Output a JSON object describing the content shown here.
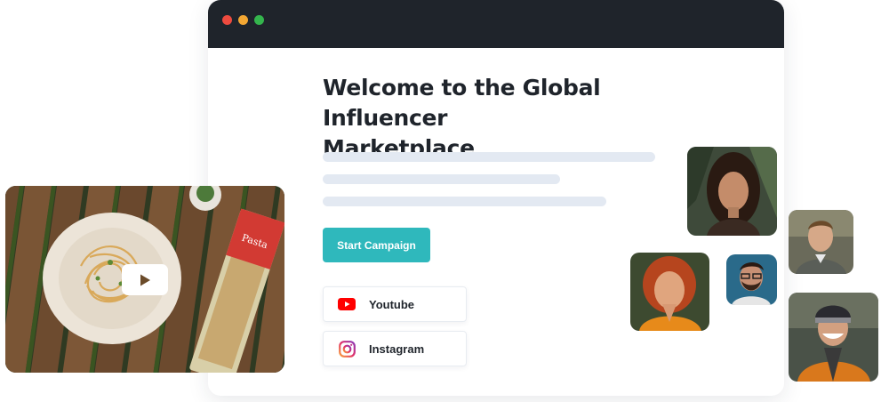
{
  "window": {
    "controls": [
      "close",
      "minimize",
      "maximize"
    ]
  },
  "hero": {
    "title_line1": "Welcome to the Global Influencer",
    "title_line2": "Marketplace",
    "cta_label": "Start Campaign"
  },
  "platforms": [
    {
      "label": "Youtube",
      "icon": "youtube-icon",
      "color": "#ff0000"
    },
    {
      "label": "Instagram",
      "icon": "instagram-icon",
      "color": "#e1306c"
    }
  ],
  "media": {
    "video_icon": "play-icon"
  },
  "colors": {
    "titlebar": "#1f242b",
    "accent": "#2fb8bc",
    "skeleton": "#e3e9f2",
    "heading": "#1f242b"
  }
}
